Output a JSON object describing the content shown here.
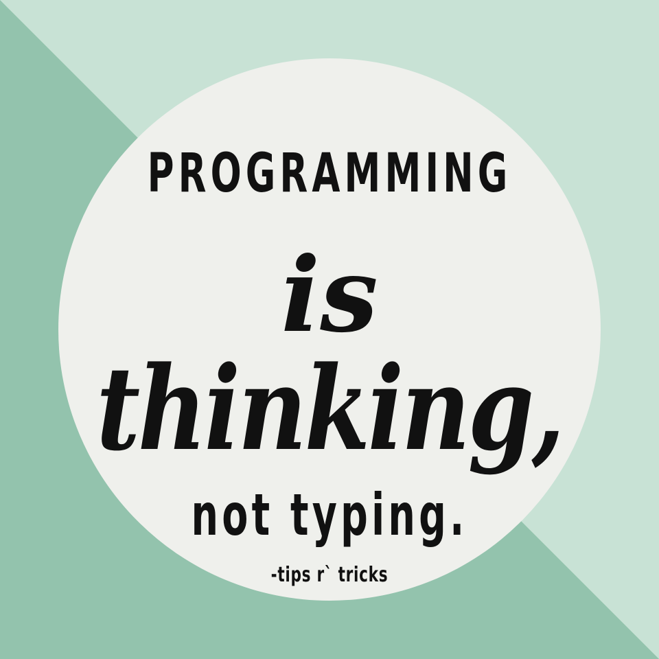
{
  "colors": {
    "background_light": "#c8e2d5",
    "background_dark": "#93c3ad",
    "circle": "#eff0ec",
    "text": "#111111"
  },
  "quote": {
    "line1": "PROGRAMMING",
    "line2": "is",
    "line3": "thinking,",
    "line4": "not typing."
  },
  "credit": "-tips r` tricks"
}
